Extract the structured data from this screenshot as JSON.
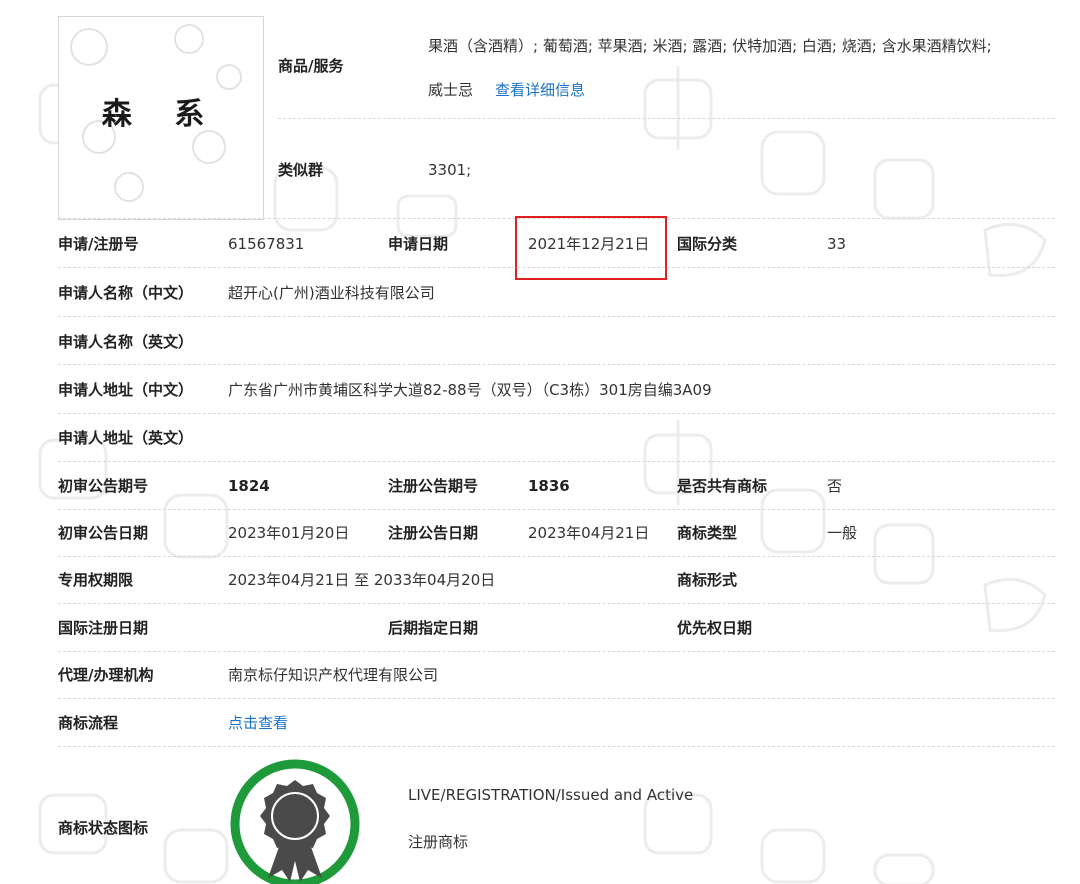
{
  "header": {
    "logo_text": "森 系",
    "goods_label": "商品/服务",
    "goods_line1": "果酒（含酒精）; 葡萄酒; 苹果酒; 米酒; 露酒; 伏特加酒; 白酒; 烧酒; 含水果酒精饮料;",
    "goods_line2": "威士忌",
    "goods_link": "查看详细信息",
    "similar_label": "类似群",
    "similar_value": "3301;"
  },
  "rows": {
    "reg_no_label": "申请/注册号",
    "reg_no_value": "61567831",
    "app_date_label": "申请日期",
    "app_date_value": "2021年12月21日",
    "intl_class_label": "国际分类",
    "intl_class_value": "33",
    "applicant_cn_label": "申请人名称（中文）",
    "applicant_cn_value": "超开心(广州)酒业科技有限公司",
    "applicant_en_label": "申请人名称（英文）",
    "address_cn_label": "申请人地址（中文）",
    "address_cn_value": "广东省广州市黄埔区科学大道82-88号（双号）（C3栋）301房自编3A09",
    "address_en_label": "申请人地址（英文）",
    "prelim_issue_label": "初审公告期号",
    "prelim_issue_value": "1824",
    "reg_issue_label": "注册公告期号",
    "reg_issue_value": "1836",
    "shared_label": "是否共有商标",
    "shared_value": "否",
    "prelim_date_label": "初审公告日期",
    "prelim_date_value": "2023年01月20日",
    "reg_date_label": "注册公告日期",
    "reg_date_value": "2023年04月21日",
    "tm_type_label": "商标类型",
    "tm_type_value": "一般",
    "term_label": "专用权期限",
    "term_value": "2023年04月21日 至 2033年04月20日",
    "tm_form_label": "商标形式",
    "intl_reg_date_label": "国际注册日期",
    "later_date_label": "后期指定日期",
    "priority_date_label": "优先权日期",
    "agent_label": "代理/办理机构",
    "agent_value": "南京标仔知识产权代理有限公司",
    "process_label": "商标流程",
    "process_link": "点击查看",
    "status_icon_label": "商标状态图标",
    "status_en": "LIVE/REGISTRATION/Issued and Active",
    "status_cn": "注册商标"
  },
  "colors": {
    "link": "#1a73c8",
    "highlight_box": "#e02020",
    "status_ring": "#1f9a3a",
    "badge": "#4a4a4a"
  },
  "icons": {
    "status": "award-ribbon-icon"
  }
}
